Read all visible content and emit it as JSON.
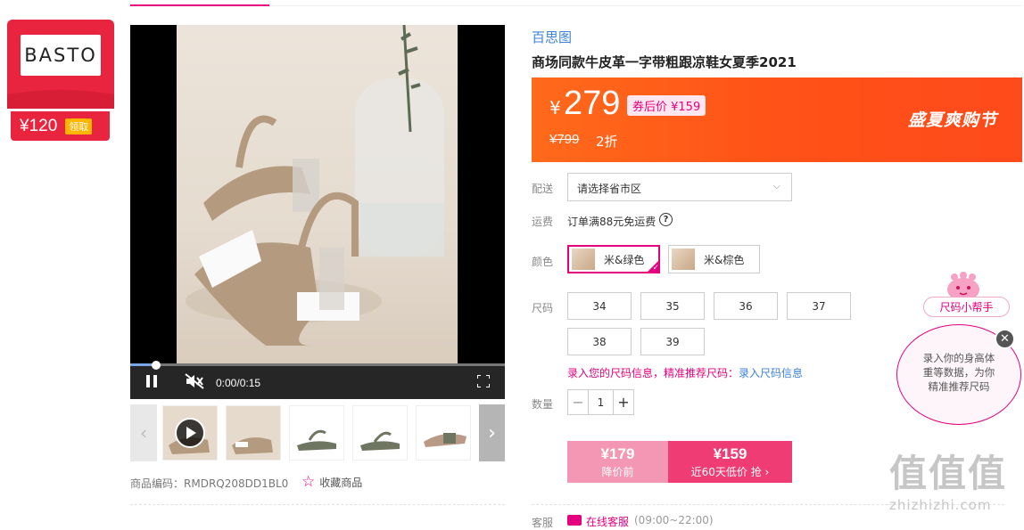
{
  "brand": {
    "logo_text": "BASTO",
    "coupon_amount": "¥120",
    "coupon_claim": "领取"
  },
  "video": {
    "time": "0:00/0:15",
    "progress": 0.07
  },
  "product": {
    "code_label": "商品编码：",
    "code": "RMDRQ208DD1BL0",
    "favorite_label": "收藏商品",
    "shop_name": "百思图",
    "title": "商场同款牛皮革一字带粗跟凉鞋女夏季2021"
  },
  "price": {
    "currency": "¥",
    "current": "279",
    "coupon_price": "券后价 ¥159",
    "original": "¥799",
    "discount": "2折",
    "promo_title": "盛夏爽购节"
  },
  "shipping": {
    "label": "配送",
    "select_placeholder": "请选择省市区",
    "freight_label": "运费",
    "freight_text": "订单满88元免运费",
    "help_icon_text": "?"
  },
  "color": {
    "label": "颜色",
    "options": [
      {
        "label": "米&绿色",
        "selected": true
      },
      {
        "label": "米&棕色",
        "selected": false
      }
    ]
  },
  "size": {
    "label": "尺码",
    "options": [
      "34",
      "35",
      "36",
      "37",
      "38",
      "39"
    ],
    "tip_text": "录入您的尺码信息，精准推荐尺码：",
    "tip_link": "录入尺码信息"
  },
  "quantity": {
    "label": "数量",
    "minus": "−",
    "value": "1",
    "plus": "+"
  },
  "buy": {
    "before_price": "¥179",
    "before_label": "降价前",
    "now_price": "¥159",
    "now_label": "近60天低价 抢 ›"
  },
  "service": {
    "label": "客服",
    "link": "在线客服",
    "hours": "(09:00~22:00)"
  },
  "helper": {
    "label": "尺码小帮手",
    "bubble_line1": "录入你的身高体",
    "bubble_line2": "重等数据，为你",
    "bubble_line3": "精准推荐尺码",
    "close": "✕"
  },
  "watermark": {
    "main": "值值值",
    "sub": "zhizhizhi.com"
  },
  "colors": {
    "accent": "#e4007f",
    "banner": "#ff5a1a",
    "brand_red": "#e8243e",
    "link_blue": "#3b82d8"
  }
}
